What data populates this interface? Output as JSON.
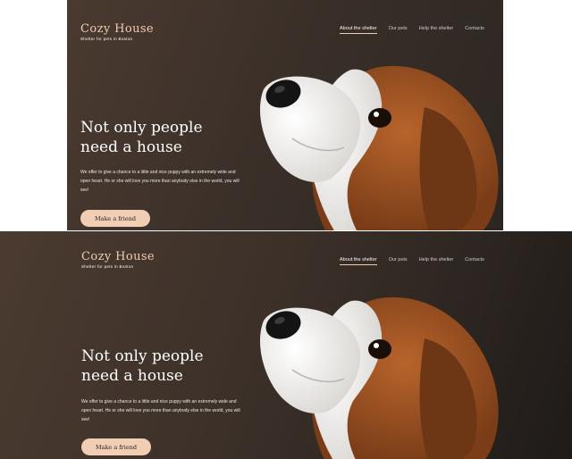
{
  "brand": {
    "title": "Cozy House",
    "subtitle": "Shelter for pets in Boston"
  },
  "nav": [
    {
      "label": "About the shelter",
      "active": true
    },
    {
      "label": "Our pets",
      "active": false
    },
    {
      "label": "Help the shelter",
      "active": false
    },
    {
      "label": "Contacts",
      "active": false
    }
  ],
  "hero": {
    "headline": "Not only people need a house",
    "description": "We offer to give a chance to a little and nice puppy with an extremely wide and open heart. He or she will love you more than anybody else in the world, you will see!",
    "cta_label": "Make a friend"
  },
  "colors": {
    "accent": "#f1cdb3",
    "background_dark": "#3b3029",
    "text_light": "#ffffff"
  },
  "image": {
    "name": "beagle-puppy-photo"
  }
}
